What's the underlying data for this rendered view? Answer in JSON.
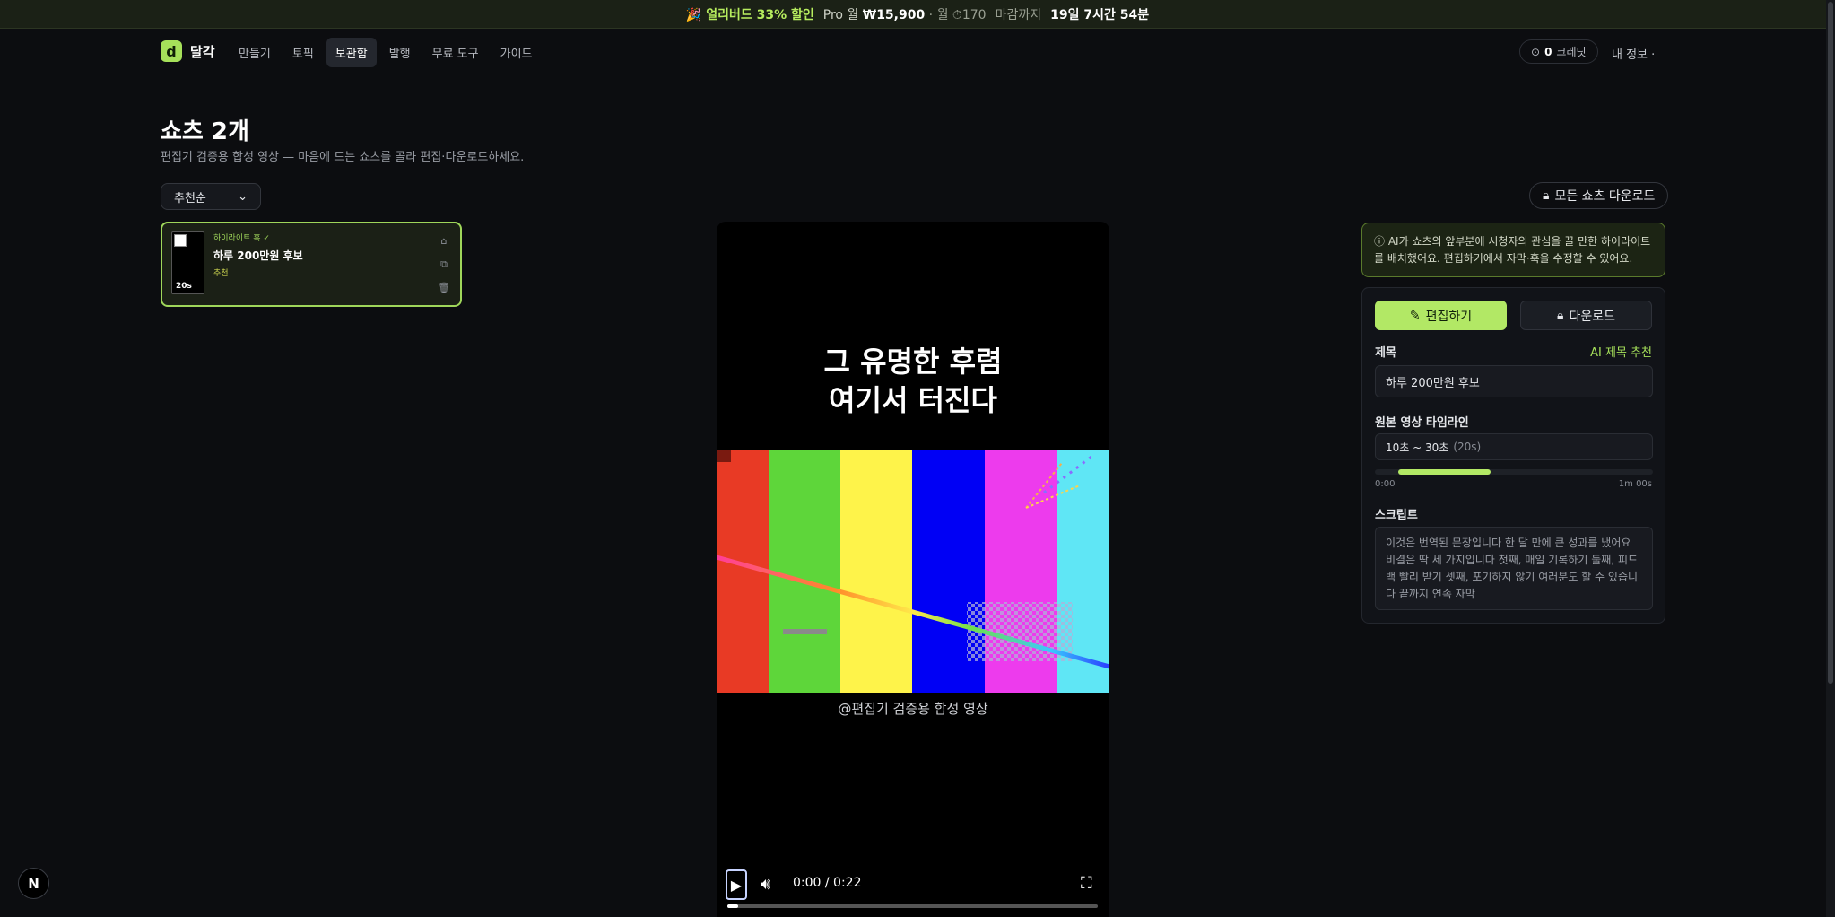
{
  "banner": {
    "promo": "🎉 얼리버드 33% 할인",
    "plan": "Pro 월",
    "price": "₩15,900",
    "per_month": "· 월",
    "remaining_icon": "clock-icon",
    "remaining_count": "170",
    "deadline_label": "마감까지",
    "deadline_value": "19일 7시간 54분"
  },
  "nav": {
    "logo_letter": "d",
    "logo_text": "달각",
    "items": [
      "만들기",
      "토픽",
      "보관함",
      "발행",
      "무료 도구",
      "가이드"
    ],
    "active_item": "보관함",
    "credit_icon": "coin-icon",
    "credit_count": "0",
    "credit_label": "크레딧",
    "my_info": "내 정보 ·"
  },
  "page": {
    "title": "쇼츠 2개",
    "subtitle": "편집기 검증용 합성 영상 — 마음에 드는 쇼츠를 골라 편집·다운로드하세요.",
    "sort_value": "추천순",
    "download_all": "모든 쇼츠 다운로드"
  },
  "shorts_list": [
    {
      "tag": "하이라이트 훅 ✓",
      "title": "하루 200만원 후보",
      "badge": "추천",
      "duration": "20s"
    }
  ],
  "player": {
    "caption_line1": "그 유명한 후렴",
    "caption_line2": "여기서 터진다",
    "handle": "@편집기 검증용 합성 영상",
    "time": "0:00 / 0:22",
    "progress": 0.03,
    "bar_colors": [
      "#e83a25",
      "#5ed63a",
      "#fef34a",
      "#0000f5",
      "#ed3bed",
      "#5fe6f5"
    ]
  },
  "editor": {
    "info": "ⓘ AI가 쇼츠의 앞부분에 시청자의 관심을 끌 만한 하이라이트를 배치했어요. 편집하기에서 자막·훅을 수정할 수 있어요.",
    "edit_button": "편집하기",
    "download_button": "다운로드",
    "title_label": "제목",
    "ai_title_suggest": "AI 제목 추천",
    "title_value": "하루 200만원 후보",
    "timeline_label": "원본 영상 타임라인",
    "timeline_range": "10초 ~ 30초",
    "timeline_duration": "(20s)",
    "timeline_start_label": "0:00",
    "timeline_end_label": "1m 00s",
    "timeline_selection": [
      10,
      30
    ],
    "timeline_total_seconds": 60,
    "script_label": "스크립트",
    "script_text": "이것은 번역된 문장입니다 한 달 만에 큰 성과를 냈어요 비결은 딱 세 가지입니다 첫째, 매일 기록하기 둘째, 피드백 빨리 받기 셋째, 포기하지 않기 여러분도 할 수 있습니다 끝까지 연속 자막"
  },
  "dev_badge": "N"
}
